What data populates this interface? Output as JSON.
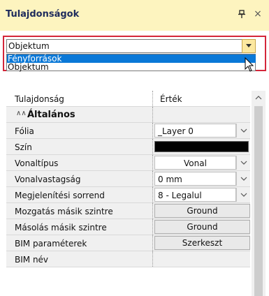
{
  "panel": {
    "title": "Tulajdonságok",
    "pin_symbol": "↧",
    "close_symbol": "×"
  },
  "object_selector": {
    "value": "Objektum",
    "options": [
      "Fényforrások",
      "Objektum"
    ],
    "highlighted_option": "Fényforrások",
    "highlight_color": "#0a78d7",
    "frame_color": "#d4263a"
  },
  "grid": {
    "columns": {
      "name": "Tulajdonság",
      "value": "Érték"
    },
    "section": {
      "chevron": "∧∧",
      "label": "Általános"
    },
    "rows": [
      {
        "label": "Fólia",
        "value": "_Layer 0"
      },
      {
        "label": "Szín",
        "value_color": "#000000"
      },
      {
        "label": "Vonaltípus",
        "value": "Vonal"
      },
      {
        "label": "Vonalvastagság",
        "value": "0 mm"
      },
      {
        "label": "Megjelenítési sorrend",
        "value": "8 - Legalul"
      },
      {
        "label": "Mozgatás másik szintre",
        "value": "Ground"
      },
      {
        "label": "Másolás másik szintre",
        "value": "Ground"
      },
      {
        "label": "BIM paraméterek",
        "value": "Szerkeszt"
      },
      {
        "label": "BIM név",
        "value": ""
      }
    ]
  }
}
